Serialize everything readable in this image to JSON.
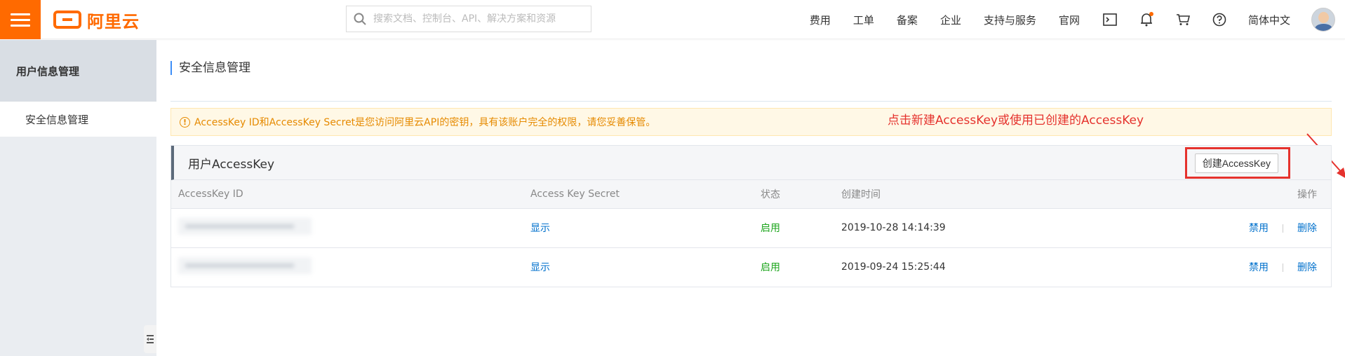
{
  "header": {
    "logo_text": "阿里云",
    "search_placeholder": "搜索文档、控制台、API、解决方案和资源",
    "nav": [
      "费用",
      "工单",
      "备案",
      "企业",
      "支持与服务",
      "官网"
    ],
    "language": "简体中文"
  },
  "sidebar": {
    "title": "用户信息管理",
    "items": [
      {
        "label": "安全信息管理"
      }
    ]
  },
  "main": {
    "page_title": "安全信息管理",
    "annotation": "点击新建AccessKey或使用已创建的AccessKey",
    "alert": "AccessKey ID和AccessKey Secret是您访问阿里云API的密钥，具有该账户完全的权限，请您妥善保管。",
    "panel": {
      "title": "用户AccessKey",
      "create_button": "创建AccessKey",
      "columns": [
        "AccessKey ID",
        "Access Key Secret",
        "状态",
        "创建时间",
        "操作"
      ],
      "rows": [
        {
          "secret_link": "显示",
          "status": "启用",
          "created": "2019-10-28 14:14:39",
          "action_disable": "禁用",
          "action_delete": "删除"
        },
        {
          "secret_link": "显示",
          "status": "启用",
          "created": "2019-09-24 15:25:44",
          "action_disable": "禁用",
          "action_delete": "删除"
        }
      ]
    }
  },
  "colors": {
    "brand": "#ff6a00",
    "link": "#0070cc",
    "status_on": "#1ca51c",
    "annotation": "#e5322d",
    "alert": "#e68a00"
  },
  "icons": [
    "menu-icon",
    "search-icon",
    "terminal-icon",
    "bell-icon",
    "cart-icon",
    "help-icon",
    "collapse-icon"
  ]
}
